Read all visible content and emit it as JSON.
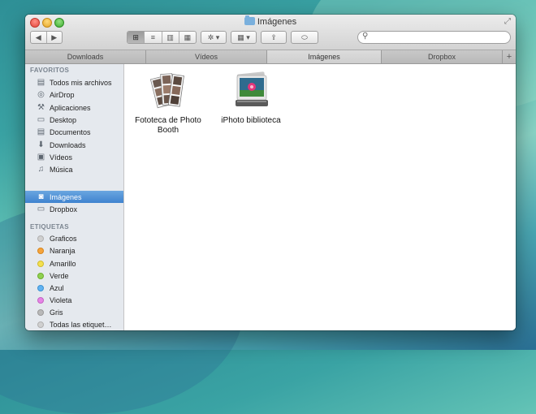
{
  "window": {
    "title": "Imágenes",
    "icon": "folder-icon",
    "fullscreen_glyph": "⤢"
  },
  "toolbar": {
    "back": "◀",
    "forward": "▶",
    "view_icon": "⊞",
    "view_list": "≡",
    "view_columns": "▥",
    "view_coverflow": "▦",
    "action": "✲ ▾",
    "arrange": "▦ ▾",
    "share": "⇪",
    "tag": "⬭",
    "search_placeholder": "",
    "search_value": ""
  },
  "tabs": [
    {
      "label": "Downloads",
      "active": false
    },
    {
      "label": "Vídeos",
      "active": false
    },
    {
      "label": "Imágenes",
      "active": true
    },
    {
      "label": "Dropbox",
      "active": false
    }
  ],
  "tab_add": "+",
  "sidebar": {
    "favorites_title": "FAVORITOS",
    "favorites": [
      {
        "label": "Todos mis archivos",
        "icon": "all-files-icon",
        "glyph": "▤"
      },
      {
        "label": "AirDrop",
        "icon": "airdrop-icon",
        "glyph": "◎"
      },
      {
        "label": "Aplicaciones",
        "icon": "applications-icon",
        "glyph": "⚒"
      },
      {
        "label": "Desktop",
        "icon": "desktop-icon",
        "glyph": "▭"
      },
      {
        "label": "Documentos",
        "icon": "documents-icon",
        "glyph": "▤"
      },
      {
        "label": "Downloads",
        "icon": "downloads-icon",
        "glyph": "⬇"
      },
      {
        "label": "Vídeos",
        "icon": "movies-icon",
        "glyph": "▣"
      },
      {
        "label": "Música",
        "icon": "music-icon",
        "glyph": "♫"
      },
      {
        "label": "Imágenes",
        "icon": "camera-icon",
        "glyph": "◙",
        "active": true
      },
      {
        "label": "Dropbox",
        "icon": "folder-icon",
        "glyph": "▭"
      }
    ],
    "tags_title": "ETIQUETAS",
    "tags": [
      {
        "label": "Graficos",
        "color": "#d0d0d0"
      },
      {
        "label": "Naranja",
        "color": "#f5a43c"
      },
      {
        "label": "Amarillo",
        "color": "#f4e04f"
      },
      {
        "label": "Verde",
        "color": "#8fd14f"
      },
      {
        "label": "Azul",
        "color": "#61b3f2"
      },
      {
        "label": "Violeta",
        "color": "#e685e6"
      },
      {
        "label": "Gris",
        "color": "#b9b9b9"
      },
      {
        "label": "Todas las etiquet…",
        "color": "#d0d0d0"
      }
    ]
  },
  "files": [
    {
      "label": "Fototeca de Photo Booth",
      "icon": "photo-booth-icon"
    },
    {
      "label": "iPhoto biblioteca",
      "icon": "iphoto-icon"
    }
  ]
}
